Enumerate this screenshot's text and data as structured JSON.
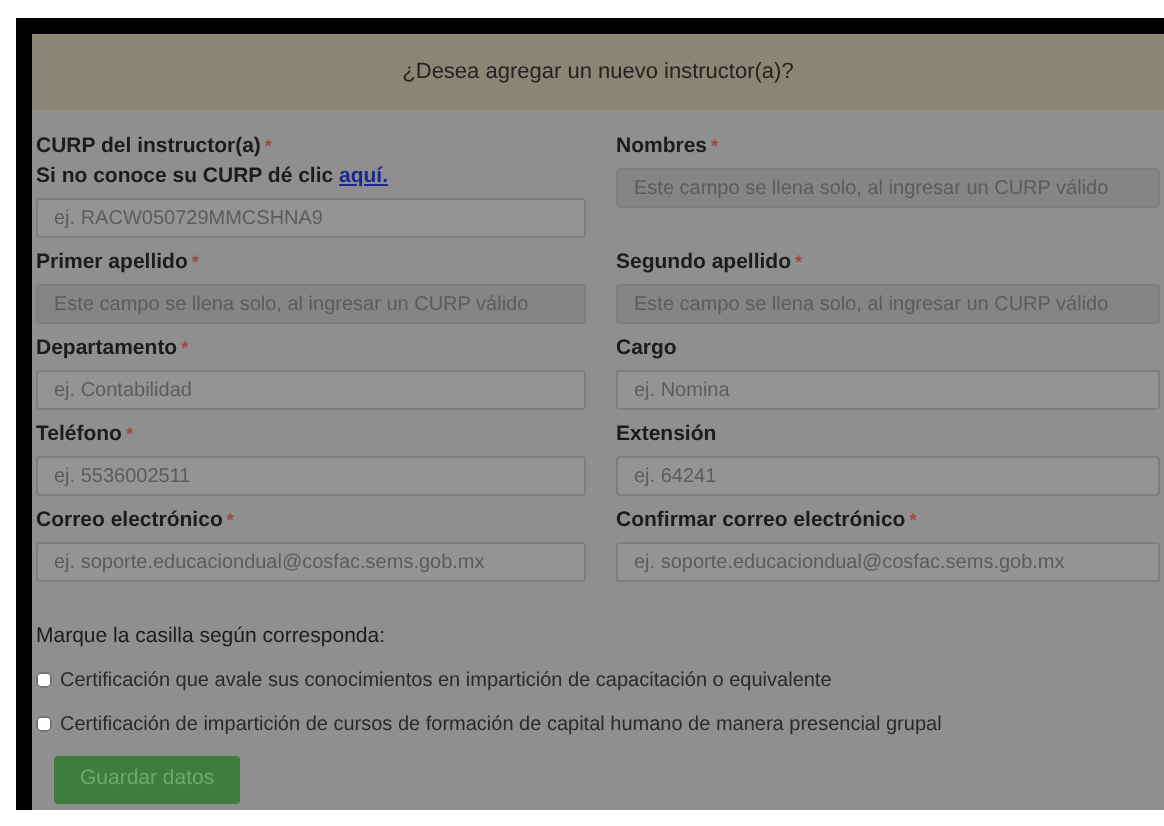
{
  "dialog": {
    "title": "¿Desea agregar un nuevo instructor(a)?"
  },
  "fields": [
    {
      "label": "CURP del instructor(a)",
      "required_mark": "*",
      "hint": "Si no conoce su CURP dé clic",
      "hint_link": "aquí.",
      "placeholder": "ej. RACW050729MMCSHNA9",
      "disabled": false
    },
    {
      "label": "Nombres",
      "required_mark": "*",
      "placeholder": "Este campo se llena solo, al ingresar un CURP válido",
      "disabled": true
    },
    {
      "label": "Primer apellido",
      "required_mark": "*",
      "placeholder": "Este campo se llena solo, al ingresar un CURP válido",
      "disabled": true
    },
    {
      "label": "Segundo apellido",
      "required_mark": "*",
      "placeholder": "Este campo se llena solo, al ingresar un CURP válido",
      "disabled": true
    },
    {
      "label": "Departamento",
      "required_mark": "*",
      "placeholder": "ej. Contabilidad",
      "disabled": false
    },
    {
      "label": "Cargo",
      "placeholder": "ej. Nomina",
      "disabled": false
    },
    {
      "label": "Teléfono",
      "required_mark": "*",
      "placeholder": "ej. 5536002511",
      "disabled": false
    },
    {
      "label": "Extensión",
      "placeholder": "ej. 64241",
      "disabled": false
    },
    {
      "label": "Correo electrónico",
      "required_mark": "*",
      "placeholder": "ej. soporte.educaciondual@cosfac.sems.gob.mx",
      "disabled": false
    },
    {
      "label": "Confirmar correo electrónico",
      "required_mark": "*",
      "placeholder": "ej. soporte.educaciondual@cosfac.sems.gob.mx",
      "disabled": false
    }
  ],
  "checkbox_prompt": "Marque la casilla según corresponda:",
  "checkboxes": [
    {
      "label": "Certificación que avale sus conocimientos en impartición de capacitación o equivalente",
      "checked": false
    },
    {
      "label": "Certificación de impartición de cursos de formación de capital humano de manera presencial grupal",
      "checked": false
    }
  ],
  "submit_button": "Guardar datos"
}
